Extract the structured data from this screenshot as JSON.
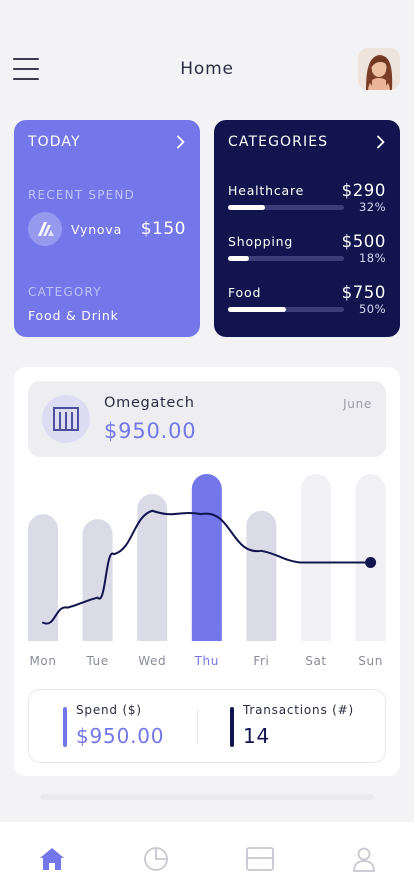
{
  "header": {
    "title": "Home"
  },
  "today": {
    "heading": "TODAY",
    "recent_label": "RECENT SPEND",
    "merchant": "Vynova",
    "amount": "$150",
    "category_label": "CATEGORY",
    "category": "Food & Drink"
  },
  "categories": {
    "heading": "CATEGORIES",
    "items": [
      {
        "name": "Healthcare",
        "amount": "$290",
        "percent": "32%",
        "fill": 0.32
      },
      {
        "name": "Shopping",
        "amount": "$500",
        "percent": "18%",
        "fill": 0.18
      },
      {
        "name": "Food",
        "amount": "$750",
        "percent": "50%",
        "fill": 0.5
      }
    ]
  },
  "company": {
    "name": "Omegatech",
    "amount": "$950.00",
    "month": "June"
  },
  "chart_data": {
    "type": "bar",
    "categories": [
      "Mon",
      "Tue",
      "Wed",
      "Thu",
      "Fri",
      "Sat",
      "Sun"
    ],
    "bar_values": [
      0.76,
      0.73,
      0.88,
      1.0,
      0.78,
      1.0,
      1.0
    ],
    "bar_states": [
      "past",
      "past",
      "past",
      "selected",
      "past",
      "future",
      "future"
    ],
    "highlight_index": 3,
    "line_values": [
      0.11,
      0.2,
      0.26,
      0.52,
      0.78,
      0.76,
      0.54,
      0.47,
      0.47
    ],
    "line_x": [
      0.0,
      0.45,
      1.0,
      1.3,
      2.0,
      2.9,
      4.0,
      4.7,
      6.0
    ]
  },
  "stats": {
    "spend_label": "Spend ($)",
    "spend_value": "$950.00",
    "tx_label": "Transactions (#)",
    "tx_value": "14"
  },
  "colors": {
    "accent": "#7477ea",
    "navy": "#12154d",
    "bar_past": "#dadbe7",
    "bar_future": "#f1f1f5"
  },
  "tabs": [
    {
      "icon": "home-icon"
    },
    {
      "icon": "pie-chart-icon"
    },
    {
      "icon": "card-icon"
    },
    {
      "icon": "profile-icon"
    }
  ]
}
